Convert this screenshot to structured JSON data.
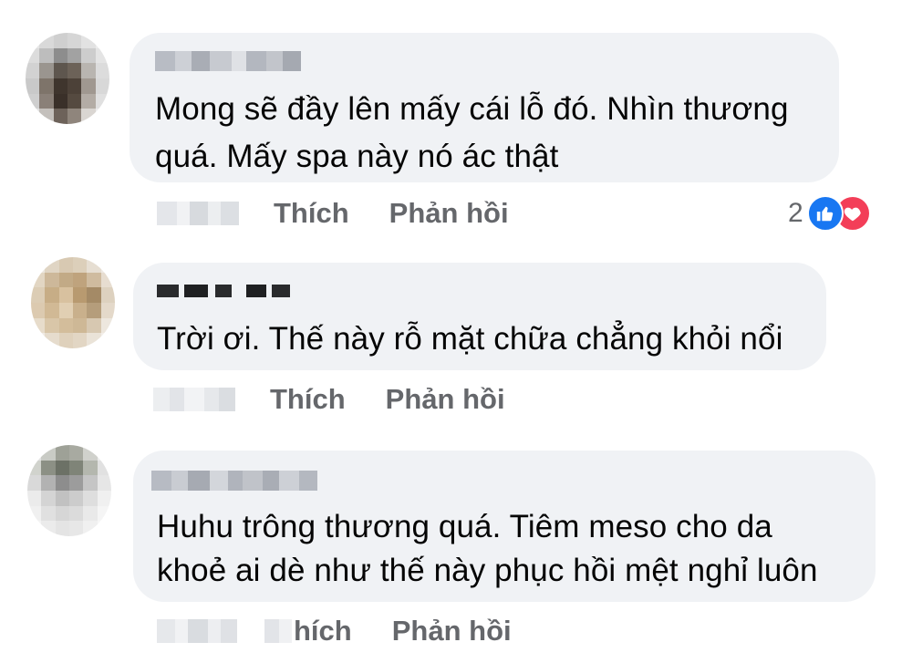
{
  "comments": [
    {
      "text_lines": [
        "Mong sẽ đầy lên mấy cái lỗ đó. Nhìn thương",
        "quá. Mấy spa này nó ác thật"
      ],
      "actions": {
        "like": "Thích",
        "reply": "Phản hồi"
      },
      "reactions": {
        "count": "2",
        "types": [
          "like-icon",
          "love-icon"
        ]
      }
    },
    {
      "text_lines": [
        "Trời ơi. Thế này rỗ mặt chữa chẳng khỏi nổi"
      ],
      "actions": {
        "like": "Thích",
        "reply": "Phản hồi"
      }
    },
    {
      "text_lines": [
        "Huhu trông thương quá. Tiêm meso cho da",
        "khoẻ ai dè như thế này phục hồi mệt nghỉ luôn"
      ],
      "actions": {
        "like": "hích",
        "reply": "Phản hồi"
      }
    }
  ],
  "colors": {
    "bubble": "#f0f2f5",
    "text": "#050505",
    "secondary": "#65676b",
    "like_blue": "#1877f2",
    "love_red": "#f33e58"
  }
}
